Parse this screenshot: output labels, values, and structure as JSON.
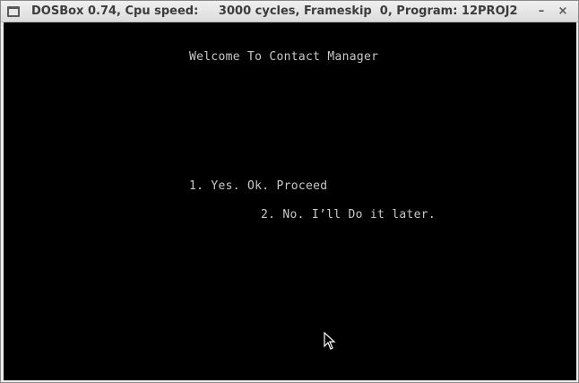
{
  "window": {
    "title": "DOSBox 0.74, Cpu speed:     3000 cycles, Frameskip  0, Program: 12PROJ2",
    "minimize_glyph": "–",
    "close_glyph": "×"
  },
  "screen": {
    "welcome_text": "Welcome To Contact Manager",
    "option_1": "1. Yes. Ok. Proceed",
    "option_2": "2. No. I’ll Do it later."
  },
  "icons": {
    "menu": "window-menu-icon",
    "minimize": "minimize-icon",
    "close": "close-icon",
    "cursor": "mouse-pointer-icon"
  },
  "colors": {
    "screen_bg": "#000000",
    "screen_text": "#c8c8c8",
    "titlebar_text": "#3c3c3c"
  }
}
